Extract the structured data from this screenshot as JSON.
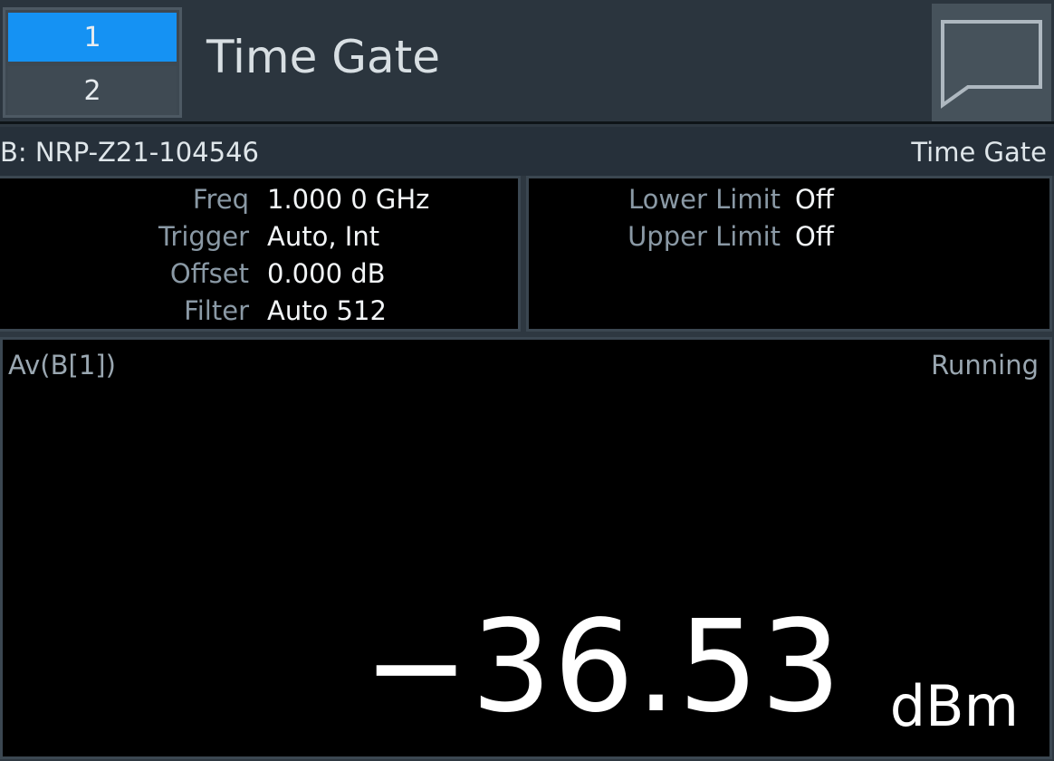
{
  "header": {
    "tabs": [
      {
        "label": "1",
        "selected": true
      },
      {
        "label": "2",
        "selected": false
      }
    ],
    "title": "Time Gate",
    "message_icon": "chat-bubble-icon"
  },
  "sensor": {
    "name": "B: NRP-Z21-104546",
    "mode": "Time Gate"
  },
  "settings": {
    "freq": {
      "label": "Freq",
      "value": "1.000 0 GHz"
    },
    "trigger": {
      "label": "Trigger",
      "value": "Auto, Int"
    },
    "offset": {
      "label": "Offset",
      "value": "0.000 dB"
    },
    "filter": {
      "label": "Filter",
      "value": "Auto 512"
    }
  },
  "limits": {
    "lower": {
      "label": "Lower Limit",
      "value": "Off"
    },
    "upper": {
      "label": "Upper Limit",
      "value": "Off"
    }
  },
  "measurement": {
    "label": "Av(B[1])",
    "status": "Running",
    "value": "−36.53",
    "unit": "dBm"
  },
  "colors": {
    "accent": "#1592f3",
    "background": "#000000",
    "header_bg": "#2b353e"
  }
}
